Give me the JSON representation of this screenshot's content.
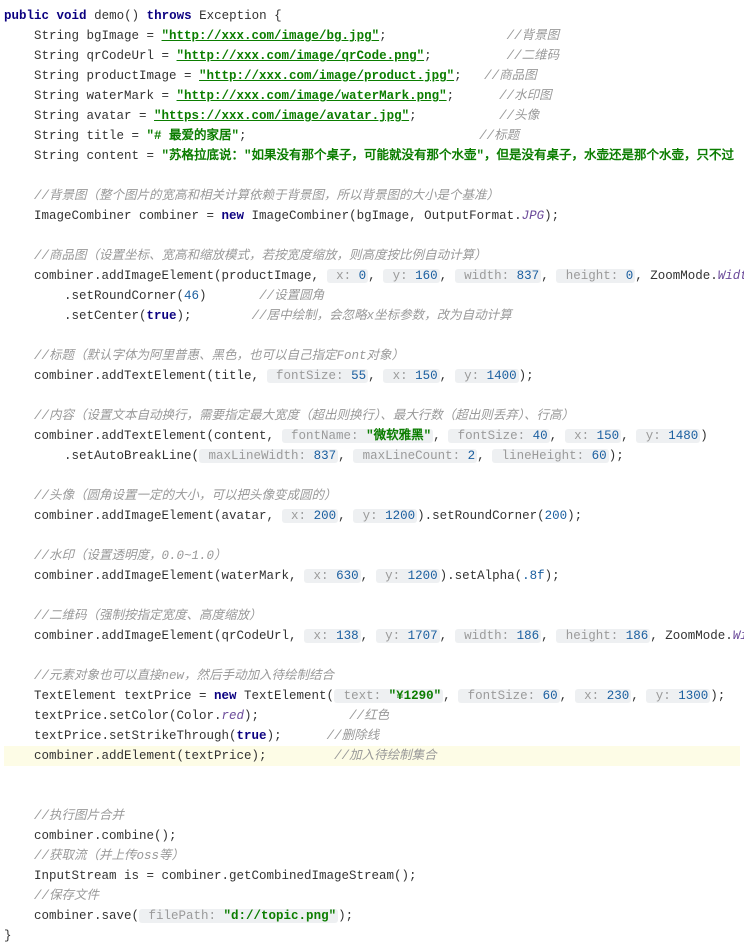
{
  "code": {
    "decl_kw1": "public",
    "decl_kw2": "void",
    "decl_name": "demo()",
    "decl_kw3": "throws",
    "decl_exc": "Exception",
    "brace_open": " {",
    "l1a": "String bgImage = ",
    "l1u": "\"http://xxx.com/image/bg.jpg\"",
    "l1b": ";",
    "l1c": "//背景图",
    "l2a": "String qrCodeUrl = ",
    "l2u": "\"http://xxx.com/image/qrCode.png\"",
    "l2b": ";",
    "l2c": "//二维码",
    "l3a": "String productImage = ",
    "l3u": "\"http://xxx.com/image/product.jpg\"",
    "l3b": ";",
    "l3c": "//商品图",
    "l4a": "String waterMark = ",
    "l4u": "\"http://xxx.com/image/waterMark.png\"",
    "l4b": ";",
    "l4c": "//水印图",
    "l5a": "String avatar = ",
    "l5u": "\"https://xxx.com/image/avatar.jpg\"",
    "l5b": ";",
    "l5c": "//头像",
    "l6a": "String title = ",
    "l6s": "\"# 最爱的家居\"",
    "l6b": ";",
    "l6c": "//标题",
    "l7a": "String content = ",
    "l7s": "\"苏格拉底说：\"如果没有那个桌子，可能就没有那个水壶\"，但是没有桌子，水壶还是那个水壶，只不过",
    "c1": "//背景图（整个图片的宽高和相关计算依赖于背景图，所以背景图的大小是个基准）",
    "l8a": "ImageCombiner combiner = ",
    "l8kw": "new",
    "l8b": " ImageCombiner(bgImage, OutputFormat.",
    "l8e": "JPG",
    "l8c": ");",
    "c2": "//商品图（设置坐标、宽高和缩放模式，若按宽度缩放，则高度按比例自动计算）",
    "l9a": "combiner.addImageElement(productImage, ",
    "p_x": " x:",
    "v0": " 0",
    "l9b": ", ",
    "p_y": " y:",
    "v160": " 160",
    "l9c": ", ",
    "p_w": " width:",
    "v837": " 837",
    "l9d": ", ",
    "p_h": " height:",
    "l9e": ", ZoomMode.",
    "en_w": "Width",
    "l9f": ")",
    "l10a": ".setRoundCorner(",
    "v46": "46",
    "l10b": ")",
    "l10c": "//设置圆角",
    "l11a": ".setCenter(",
    "kw_true": "true",
    "l11b": ");",
    "l11c": "//居中绘制，会忽略x坐标参数，改为自动计算",
    "c3": "//标题（默认字体为阿里普惠、黑色，也可以自己指定Font对象）",
    "l12a": "combiner.addTextElement(title, ",
    "p_fs": " fontSize:",
    "v55": " 55",
    "l12b": ", ",
    "v150": " 150",
    "l12c": ", ",
    "v1400": " 1400",
    "l12d": ");",
    "c4": "//内容（设置文本自动换行，需要指定最大宽度（超出则换行）、最大行数（超出则丢弃）、行高）",
    "l13a": "combiner.addTextElement(content, ",
    "p_fn": " fontName:",
    "v_mryh": " \"微软雅黑\"",
    "l13b": ", ",
    "v40": " 40",
    "v1480": " 1480",
    "l13c": ")",
    "l14a": ".setAutoBreakLine(",
    "p_mlw": " maxLineWidth:",
    "l14b": ", ",
    "p_mlc": " maxLineCount:",
    "v2": " 2",
    "p_lh": " lineHeight:",
    "v60": " 60",
    "l14c": ");",
    "c5": "//头像（圆角设置一定的大小，可以把头像变成圆的）",
    "l15a": "combiner.addImageElement(avatar, ",
    "v200": " 200",
    "v1200": " 1200",
    "l15b": ").setRoundCorner(",
    "n200": "200",
    "l15c": ");",
    "c6": "//水印（设置透明度，0.0~1.0）",
    "l16a": "combiner.addImageElement(waterMark, ",
    "v630": " 630",
    "l16b": ").setAlpha(",
    "v8f": ".8f",
    "l16c": ");",
    "c7": "//二维码（强制按指定宽度、高度缩放）",
    "l17a": "combiner.addImageElement(qrCodeUrl, ",
    "v138": " 138",
    "v1707": " 1707",
    "v186": " 186",
    "l17b": ", ZoomMode.",
    "en_wh": "WidthHeight",
    "l17c": ");",
    "c8": "//元素对象也可以直接new，然后手动加入待绘制结合",
    "l18a": "TextElement textPrice = ",
    "l18kw": "new",
    "l18b": " TextElement(",
    "p_txt": " text:",
    "v1290": " \"¥1290\"",
    "v60b": " 60",
    "v230": " 230",
    "v1300": " 1300",
    "l18c": ");",
    "l19a": "textPrice.setColor(Color.",
    "fld_red": "red",
    "l19b": ");",
    "l19c": "//红色",
    "l20a": "textPrice.setStrikeThrough(",
    "l20b": ");",
    "l20c": "//删除线",
    "l21a": "combiner.addElement(textPrice);",
    "l21c": "//加入待绘制集合",
    "c9": "//执行图片合并",
    "l22": "combiner.combine();",
    "c10": "//获取流（并上传oss等）",
    "l23": "InputStream is = combiner.getCombinedImageStream();",
    "c11": "//保存文件",
    "l24a": "combiner.save(",
    "p_fp": " filePath:",
    "v_path": " \"d://topic.png\"",
    "l24b": ");",
    "brace_close": "}"
  }
}
